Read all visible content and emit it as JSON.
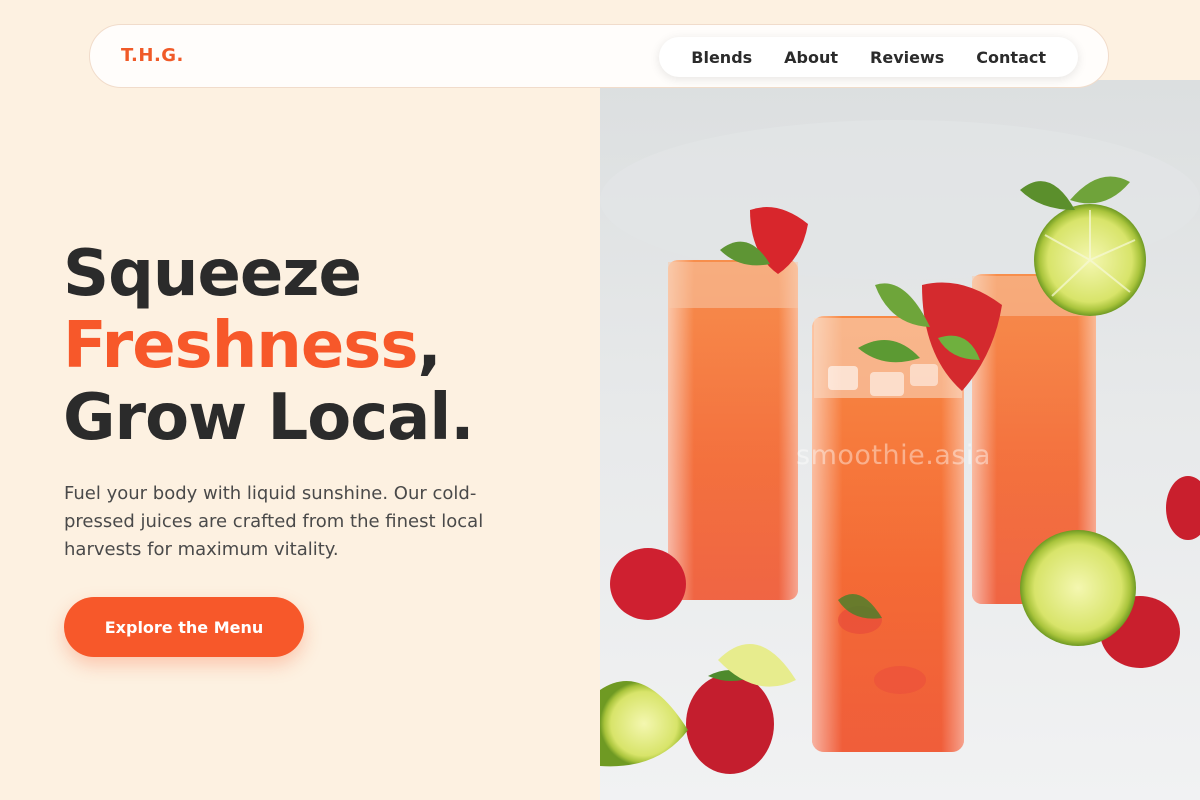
{
  "nav": {
    "logo": "T.H.G.",
    "links": [
      "Blends",
      "About",
      "Reviews",
      "Contact"
    ]
  },
  "hero": {
    "headline_line1": "Squeeze",
    "headline_accent": "Freshness",
    "headline_comma": ",",
    "headline_line3": "Grow Local.",
    "description": "Fuel your body with liquid sunshine. Our cold-pressed juices are crafted from the finest local harvests for maximum vitality.",
    "cta_label": "Explore the Menu",
    "image_watermark": "smoothie.asia"
  },
  "colors": {
    "background": "#fdf1e1",
    "accent": "#f7582a",
    "text_dark": "#2b2b2b"
  }
}
